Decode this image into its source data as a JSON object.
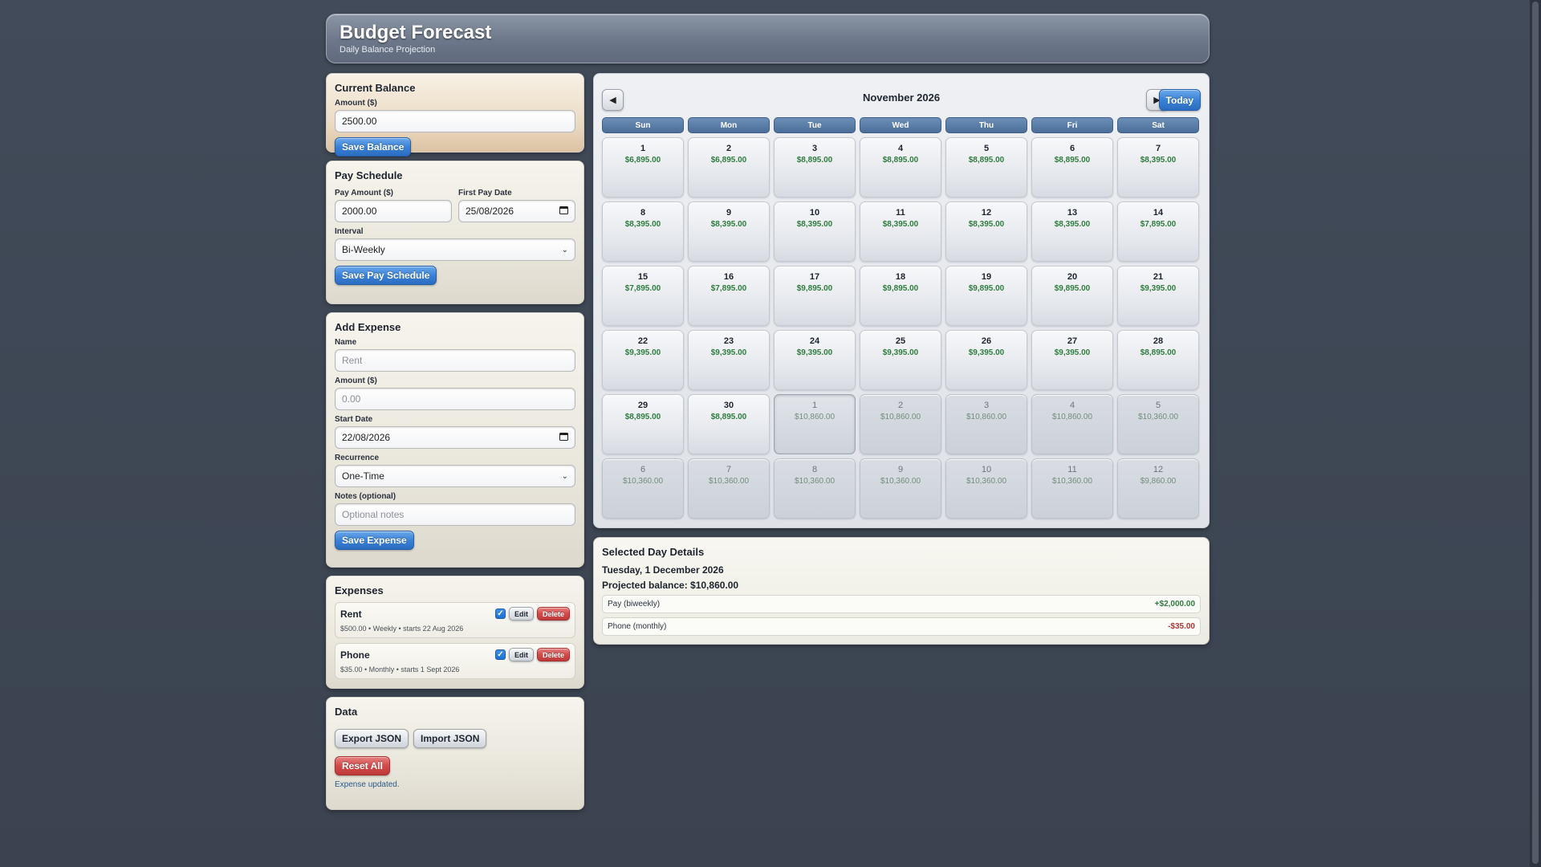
{
  "header": {
    "title": "Budget Forecast",
    "subtitle": "Daily Balance Projection"
  },
  "balance": {
    "title": "Current Balance",
    "amount_label": "Amount ($)",
    "amount_value": "2500.00",
    "save_label": "Save Balance"
  },
  "pay": {
    "title": "Pay Schedule",
    "amount_label": "Pay Amount ($)",
    "amount_value": "2000.00",
    "date_label": "First Pay Date",
    "date_value": "25/08/2026",
    "interval_label": "Interval",
    "interval_value": "Bi-Weekly",
    "save_label": "Save Pay Schedule"
  },
  "expense_form": {
    "title": "Add Expense",
    "name_label": "Name",
    "name_placeholder": "Rent",
    "amount_label": "Amount ($)",
    "amount_placeholder": "0.00",
    "start_label": "Start Date",
    "start_value": "22/08/2026",
    "recurrence_label": "Recurrence",
    "recurrence_value": "One-Time",
    "notes_label": "Notes (optional)",
    "notes_placeholder": "Optional notes",
    "save_label": "Save Expense"
  },
  "expenses": {
    "title": "Expenses",
    "edit_label": "Edit",
    "delete_label": "Delete",
    "items": [
      {
        "name": "Rent",
        "meta": "$500.00 • Weekly • starts 22 Aug 2026",
        "enabled": true
      },
      {
        "name": "Phone",
        "meta": "$35.00 • Monthly • starts 1 Sept 2026",
        "enabled": true
      }
    ]
  },
  "data_panel": {
    "title": "Data",
    "export_label": "Export JSON",
    "import_label": "Import JSON",
    "reset_label": "Reset All",
    "status": "Expense updated."
  },
  "calendar": {
    "month_title": "November 2026",
    "prev_icon": "◀",
    "next_icon": "▶",
    "today_label": "Today",
    "weekdays": [
      "Sun",
      "Mon",
      "Tue",
      "Wed",
      "Thu",
      "Fri",
      "Sat"
    ],
    "days": [
      {
        "num": "1",
        "bal": "$6,895.00"
      },
      {
        "num": "2",
        "bal": "$6,895.00"
      },
      {
        "num": "3",
        "bal": "$8,895.00"
      },
      {
        "num": "4",
        "bal": "$8,895.00"
      },
      {
        "num": "5",
        "bal": "$8,895.00"
      },
      {
        "num": "6",
        "bal": "$8,895.00"
      },
      {
        "num": "7",
        "bal": "$8,395.00"
      },
      {
        "num": "8",
        "bal": "$8,395.00"
      },
      {
        "num": "9",
        "bal": "$8,395.00"
      },
      {
        "num": "10",
        "bal": "$8,395.00"
      },
      {
        "num": "11",
        "bal": "$8,395.00"
      },
      {
        "num": "12",
        "bal": "$8,395.00"
      },
      {
        "num": "13",
        "bal": "$8,395.00"
      },
      {
        "num": "14",
        "bal": "$7,895.00"
      },
      {
        "num": "15",
        "bal": "$7,895.00"
      },
      {
        "num": "16",
        "bal": "$7,895.00"
      },
      {
        "num": "17",
        "bal": "$9,895.00"
      },
      {
        "num": "18",
        "bal": "$9,895.00"
      },
      {
        "num": "19",
        "bal": "$9,895.00"
      },
      {
        "num": "20",
        "bal": "$9,895.00"
      },
      {
        "num": "21",
        "bal": "$9,395.00"
      },
      {
        "num": "22",
        "bal": "$9,395.00"
      },
      {
        "num": "23",
        "bal": "$9,395.00"
      },
      {
        "num": "24",
        "bal": "$9,395.00"
      },
      {
        "num": "25",
        "bal": "$9,395.00"
      },
      {
        "num": "26",
        "bal": "$9,395.00"
      },
      {
        "num": "27",
        "bal": "$9,395.00"
      },
      {
        "num": "28",
        "bal": "$8,895.00"
      },
      {
        "num": "29",
        "bal": "$8,895.00"
      },
      {
        "num": "30",
        "bal": "$8,895.00"
      },
      {
        "num": "1",
        "bal": "$10,860.00",
        "other": true,
        "selected": true
      },
      {
        "num": "2",
        "bal": "$10,860.00",
        "other": true
      },
      {
        "num": "3",
        "bal": "$10,860.00",
        "other": true
      },
      {
        "num": "4",
        "bal": "$10,860.00",
        "other": true
      },
      {
        "num": "5",
        "bal": "$10,360.00",
        "other": true
      },
      {
        "num": "6",
        "bal": "$10,360.00",
        "other": true
      },
      {
        "num": "7",
        "bal": "$10,360.00",
        "other": true
      },
      {
        "num": "8",
        "bal": "$10,360.00",
        "other": true
      },
      {
        "num": "9",
        "bal": "$10,360.00",
        "other": true
      },
      {
        "num": "10",
        "bal": "$10,360.00",
        "other": true
      },
      {
        "num": "11",
        "bal": "$10,360.00",
        "other": true
      },
      {
        "num": "12",
        "bal": "$9,860.00",
        "other": true
      }
    ]
  },
  "details": {
    "title": "Selected Day Details",
    "date": "Tuesday, 1 December 2026",
    "projected": "Projected balance: $10,860.00",
    "transactions": [
      {
        "label": "Pay (biweekly)",
        "amount": "+$2,000.00",
        "positive": true
      },
      {
        "label": "Phone (monthly)",
        "amount": "-$35.00",
        "positive": false
      }
    ]
  }
}
